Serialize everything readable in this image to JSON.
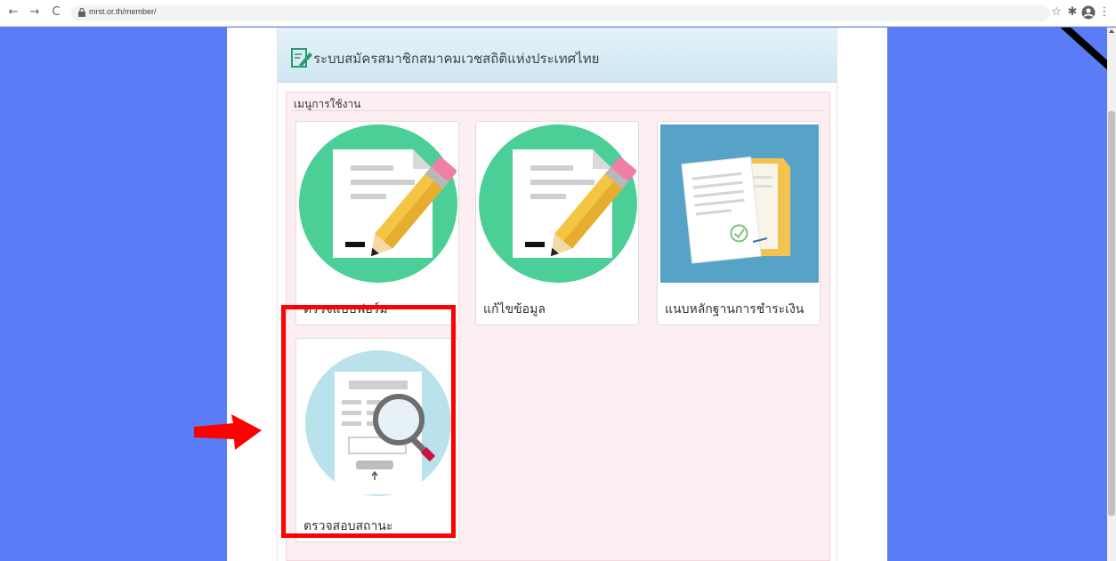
{
  "browser": {
    "url": "mrst.or.th/member/",
    "back_icon": "←",
    "forward_icon": "→",
    "reload_icon": "C",
    "star_icon": "☆",
    "extensions_icon": "✱",
    "more_icon": "⋮"
  },
  "header": {
    "title": "ระบบสมัครสมาชิกสมาคมเวชสถิติแห่งประเทศไทย"
  },
  "menu": {
    "title": "เมนูการใช้งาน",
    "cards": [
      {
        "label": "ตรวจแบบฟอร์ม",
        "icon": "document-pencil-icon"
      },
      {
        "label": "แก้ไขข้อมูล",
        "icon": "document-pencil-icon"
      },
      {
        "label": "แนบหลักฐานการชำระเงิน",
        "icon": "payment-document-icon"
      },
      {
        "label": "ตรวจสอบสถานะ",
        "icon": "search-document-icon"
      }
    ]
  },
  "colors": {
    "page_bg": "#5b7cf7",
    "green_circle": "#4ccf96",
    "payment_bg": "#57a3c7",
    "search_circle": "#b9e2ea",
    "highlight": "#ff0000"
  }
}
